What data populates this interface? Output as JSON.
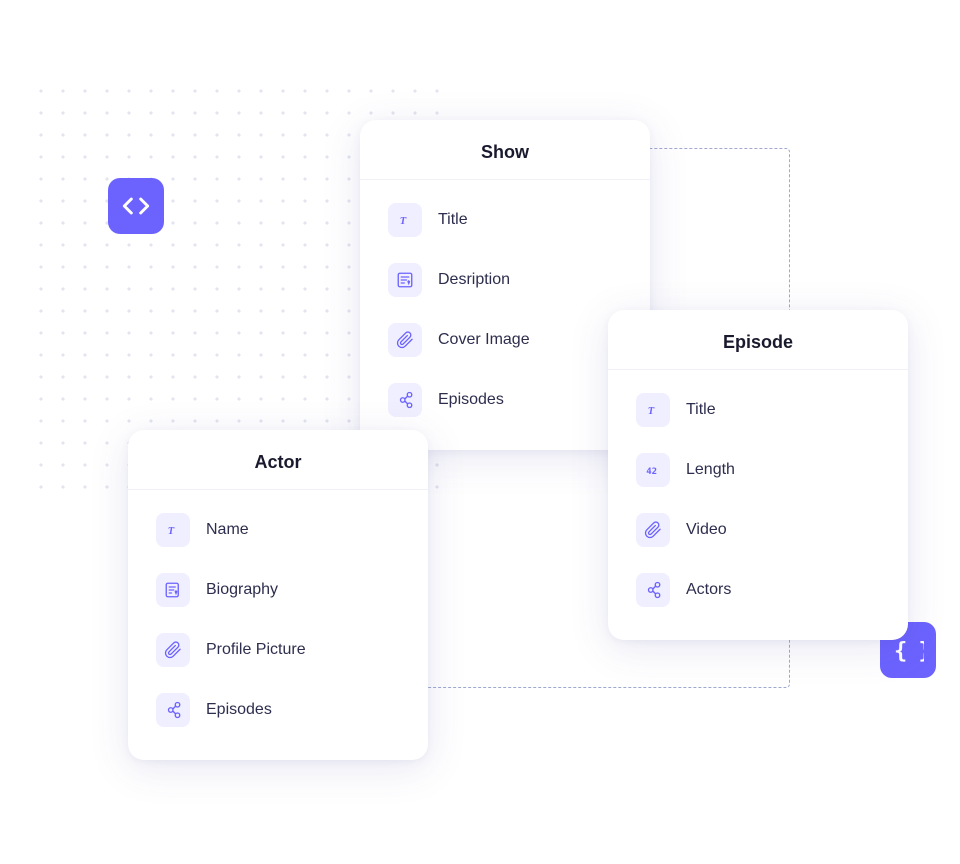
{
  "icons": {
    "code": "<>",
    "curly": "{ }"
  },
  "cards": {
    "show": {
      "title": "Show",
      "fields": [
        {
          "icon": "text",
          "label": "Title"
        },
        {
          "icon": "edit",
          "label": "Desription"
        },
        {
          "icon": "attach",
          "label": "Cover Image"
        },
        {
          "icon": "link",
          "label": "Episodes"
        }
      ]
    },
    "actor": {
      "title": "Actor",
      "fields": [
        {
          "icon": "text",
          "label": "Name"
        },
        {
          "icon": "edit",
          "label": "Biography"
        },
        {
          "icon": "attach",
          "label": "Profile Picture"
        },
        {
          "icon": "link",
          "label": "Episodes"
        }
      ]
    },
    "episode": {
      "title": "Episode",
      "fields": [
        {
          "icon": "text",
          "label": "Title"
        },
        {
          "icon": "number",
          "label": "Length"
        },
        {
          "icon": "attach",
          "label": "Video"
        },
        {
          "icon": "link",
          "label": "Actors"
        }
      ]
    }
  }
}
